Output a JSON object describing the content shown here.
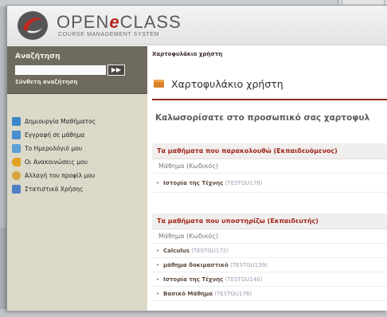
{
  "header": {
    "logo_main": "OPEN",
    "logo_accent": "e",
    "logo_tail": "CLASS",
    "logo_subtitle": "COURSE MANAGEMENT SYSTEM"
  },
  "sidebar": {
    "search_title": "Αναζήτηση",
    "search_value": "",
    "search_go": "▶▶",
    "advanced_search": "Σύνθετη αναζήτηση",
    "menu": [
      {
        "label": "Δημιουργία Μαθήματος",
        "icon": "create-course-icon",
        "color": "#3a86c8"
      },
      {
        "label": "Εγγραφή σε μάθημα",
        "icon": "enroll-icon",
        "color": "#4a8fd0"
      },
      {
        "label": "Το Ημερολόγιό μου",
        "icon": "calendar-icon",
        "color": "#5c9fd6"
      },
      {
        "label": "Οι Ανακοινώσεις μου",
        "icon": "announcements-icon",
        "color": "#e0a020"
      },
      {
        "label": "Αλλαγή του προφίλ μου",
        "icon": "profile-icon",
        "color": "#d9a53a"
      },
      {
        "label": "Στατιστικά Χρήσης",
        "icon": "stats-icon",
        "color": "#4f7fc4"
      }
    ]
  },
  "main": {
    "breadcrumb": "Χαρτοφυλάκιο χρήστη",
    "page_title": "Χαρτοφυλάκιο χρήστη",
    "welcome": "Καλωσορίσατε στο προσωπικό σας χαρτοφυλ",
    "student_panel": {
      "title": "Τα μαθήματα που παρακολουθώ (Εκπαιδευόμενος)",
      "column": "Μάθημα (Κωδικός)",
      "rows": [
        {
          "name": "Ιστορία της Τέχνης",
          "code": "(TESTGU178)"
        }
      ]
    },
    "teacher_panel": {
      "title": "Τα μαθήματα που υποστηρίζω (Εκπαιδευτής)",
      "column": "Μάθημα (Κωδικός)",
      "rows": [
        {
          "name": "Calculus",
          "code": "(TESTGU172)"
        },
        {
          "name": "μάθημα δοκιμαστικό",
          "code": "(TESTGU139)"
        },
        {
          "name": "Ιστορία της Τέχνης",
          "code": "(TESTGU140)"
        },
        {
          "name": "Βασικό Μάθημα",
          "code": "(TESTGU176)"
        }
      ]
    }
  },
  "colors": {
    "accent_red": "#a0261a",
    "sidebar_dark": "#6f6a5e",
    "sidebar_light": "#dcd9c9"
  }
}
